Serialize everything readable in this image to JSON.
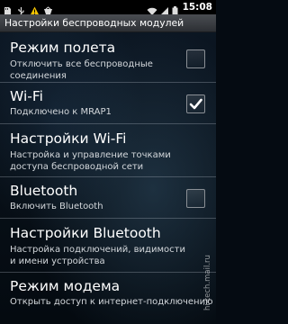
{
  "status_bar": {
    "time": "15:08",
    "icons": [
      "sd-card-icon",
      "usb-icon",
      "warning-icon",
      "notification-icon",
      "wifi-icon",
      "signal-icon",
      "battery-icon"
    ]
  },
  "title_bar": {
    "title": "Настройки беспроводных модулей"
  },
  "items": [
    {
      "title": "Режим полета",
      "summary": "Отключить все беспроводные соединения",
      "checkbox": true,
      "checked": false
    },
    {
      "title": "Wi-Fi",
      "summary": "Подключено к MRAP1",
      "checkbox": true,
      "checked": true
    },
    {
      "title": "Настройки Wi-Fi",
      "summary": "Настройка и управление точками доступа беспроводной сети",
      "checkbox": false
    },
    {
      "title": "Bluetooth",
      "summary": "Включить Bluetooth",
      "checkbox": true,
      "checked": false
    },
    {
      "title": "Настройки Bluetooth",
      "summary": "Настройка подключений, видимости и имени устройства",
      "checkbox": false
    },
    {
      "title": "Режим модема",
      "summary": "Открыть доступ к интернет-подключению",
      "checkbox": false
    }
  ],
  "watermark": "hi-tech.mail.ru",
  "colors": {
    "title_bar": "#3a3d42",
    "background": "#081018",
    "divider": "#6b737c",
    "check": "#ffffff"
  }
}
